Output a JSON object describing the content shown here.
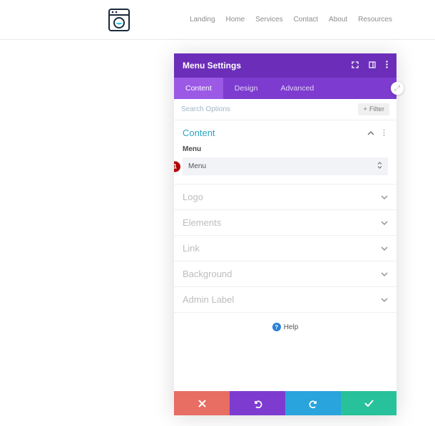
{
  "nav": {
    "items": [
      "Landing",
      "Home",
      "Services",
      "Contact",
      "About",
      "Resources"
    ]
  },
  "panel": {
    "title": "Menu Settings",
    "tabs": [
      "Content",
      "Design",
      "Advanced"
    ],
    "active_tab": 0,
    "search_placeholder": "Search Options",
    "filter_label": "Filter"
  },
  "sections": {
    "content": {
      "title": "Content",
      "menu_field_label": "Menu",
      "menu_value": "Menu"
    },
    "logo": "Logo",
    "elements": "Elements",
    "link": "Link",
    "background": "Background",
    "admin_label": "Admin Label"
  },
  "annotation": "1",
  "help_label": "Help"
}
